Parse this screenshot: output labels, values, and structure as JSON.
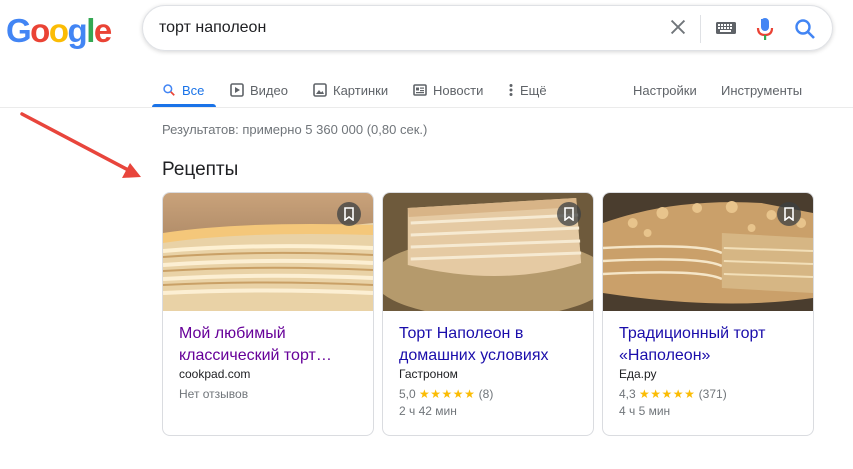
{
  "logo": {
    "letters": [
      "G",
      "o",
      "o",
      "g",
      "l",
      "e"
    ],
    "colors": [
      "#4285f4",
      "#ea4335",
      "#fbbc05",
      "#4285f4",
      "#34a853",
      "#ea4335"
    ]
  },
  "search": {
    "query": "торт наполеон",
    "icons": [
      "close-icon",
      "keyboard-icon",
      "mic-icon",
      "search-icon"
    ]
  },
  "tabs": [
    {
      "label": "Все",
      "icon": "search-icon",
      "active": true
    },
    {
      "label": "Видео",
      "icon": "play-icon"
    },
    {
      "label": "Картинки",
      "icon": "image-icon"
    },
    {
      "label": "Новости",
      "icon": "news-icon"
    },
    {
      "label": "Ещё",
      "icon": "more-vert-icon"
    },
    {
      "label": "Настройки"
    },
    {
      "label": "Инструменты"
    }
  ],
  "results_stats": "Результатов: примерно 5 360 000 (0,80 сек.)",
  "recipes": {
    "title": "Рецепты",
    "cards": [
      {
        "title": "Мой любимый классический торт…",
        "source": "cookpad.com",
        "reviews": "Нет отзывов"
      },
      {
        "title": "Торт Наполеон в домашних условиях",
        "source": "Гастроном",
        "rating": "5,0",
        "stars": "★★★★★",
        "count": "(8)",
        "time": "2 ч 42 мин"
      },
      {
        "title": "Традиционный торт «Наполеон»",
        "source": "Еда.ру",
        "rating": "4,3",
        "stars": "★★★★★",
        "count": "(371)",
        "time": "4 ч 5 мин"
      }
    ]
  },
  "colors": {
    "accent": "#1a73e8",
    "link": "#1a0dab",
    "visited": "#660099",
    "star": "#fbbc04",
    "arrow": "#e8453c"
  }
}
